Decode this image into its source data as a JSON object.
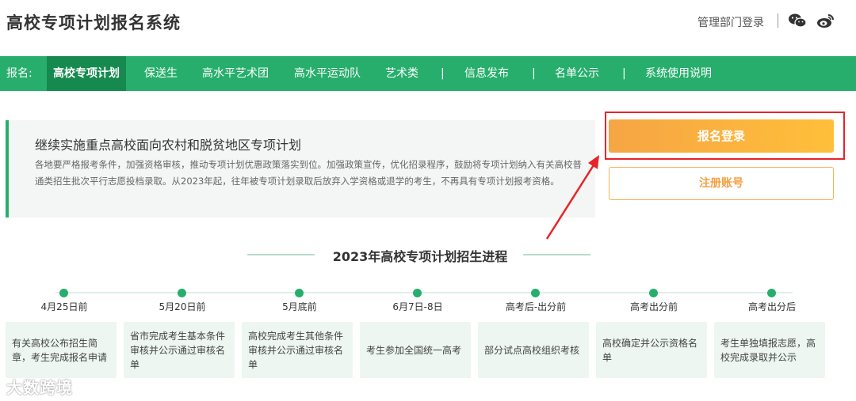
{
  "header": {
    "site_title": "高校专项计划报名系统",
    "admin_login": "管理部门登录",
    "icons": [
      "wechat-icon",
      "weibo-icon"
    ]
  },
  "nav": {
    "prefix": "报名:",
    "items": [
      {
        "label": "高校专项计划",
        "active": true
      },
      {
        "label": "保送生"
      },
      {
        "label": "高水平艺术团"
      },
      {
        "label": "高水平运动队"
      },
      {
        "label": "艺术类"
      },
      {
        "label": "信息发布"
      },
      {
        "label": "名单公示"
      },
      {
        "label": "系统使用说明"
      }
    ],
    "separator": "|"
  },
  "intro": {
    "title": "继续实施重点高校面向农村和脱贫地区专项计划",
    "text": "各地要严格报考条件，加强资格审核，推动专项计划优惠政策落实到位。加强政策宣传，优化招录程序，鼓励将专项计划纳入有关高校普通类招生批次平行志愿投档录取。从2023年起，往年被专项计划录取后放弃入学资格或退学的考生，不再具有专项计划报考资格。"
  },
  "actions": {
    "login": "报名登录",
    "register": "注册账号"
  },
  "progress": {
    "title": "2023年高校专项计划招生进程",
    "steps": [
      {
        "date": "4月25日前",
        "desc": "有关高校公布招生简章，考生完成报名申请"
      },
      {
        "date": "5月20日前",
        "desc": "省市完成考生基本条件审核并公示通过审核名单"
      },
      {
        "date": "5月底前",
        "desc": "高校完成考生其他条件审核并公示通过审核名单"
      },
      {
        "date": "6月7日-8日",
        "desc": "考生参加全国统一高考"
      },
      {
        "date": "高考后-出分前",
        "desc": "部分试点高校组织考核"
      },
      {
        "date": "高考出分前",
        "desc": "高校确定并公示资格名单"
      },
      {
        "date": "高考出分后",
        "desc": "考生单独填报志愿，高校完成录取并公示"
      }
    ]
  },
  "watermark": "大数跨境",
  "colors": {
    "brand_green": "#27ae6c",
    "active_green": "#16894f",
    "login_orange": "#f6a544",
    "highlight_red": "#e6242a"
  }
}
